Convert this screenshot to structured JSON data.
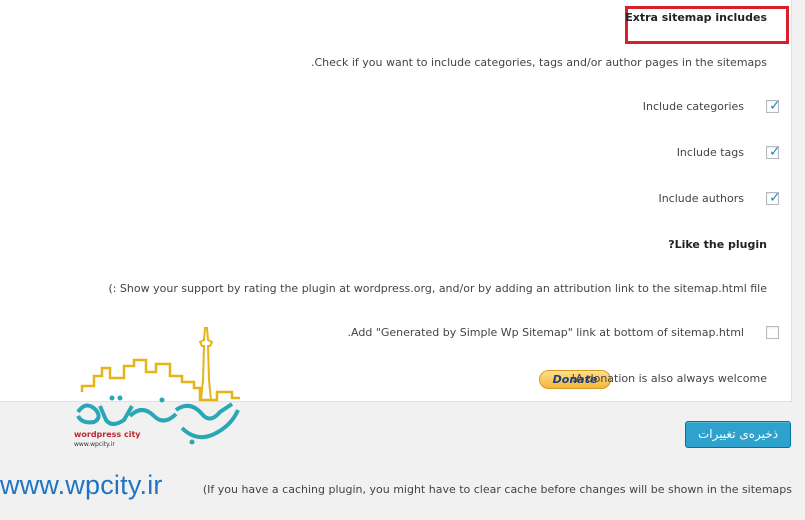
{
  "panel": {
    "heading": "Extra sitemap includes",
    "description": ".Check if you want to include categories, tags and/or author pages in the sitemaps",
    "options": [
      {
        "label": "Include categories",
        "checked": true
      },
      {
        "label": "Include tags",
        "checked": true
      },
      {
        "label": "Include authors",
        "checked": true
      }
    ],
    "like_title": "?Like the plugin",
    "support_text": "(: Show your support by rating the plugin at wordpress.org, and/or by adding an attribution link to the sitemap.html file",
    "attribution_label": ".Add \"Generated by Simple Wp Sitemap\" link at bottom of sitemap.html",
    "attribution_checked": false,
    "donate_label": "Donate",
    "donation_text": "!A donation is also always welcome"
  },
  "save_button": "ذخیره‌ی تغییرات",
  "notice": "(If you have a caching plugin, you might have to clear cache before changes will be shown in the sitemaps",
  "watermark": {
    "url": "www.wpcity.ir",
    "logo_text": "وردپرس سیتی",
    "logo_caption": "wordpress city",
    "logo_subcaption": "www.wpcity.ir"
  },
  "colors": {
    "highlight_box": "#d9202a",
    "checkmark": "#1e8cbe",
    "primary_button": "#2ea2cc",
    "watermark_url": "#1f75c4"
  }
}
